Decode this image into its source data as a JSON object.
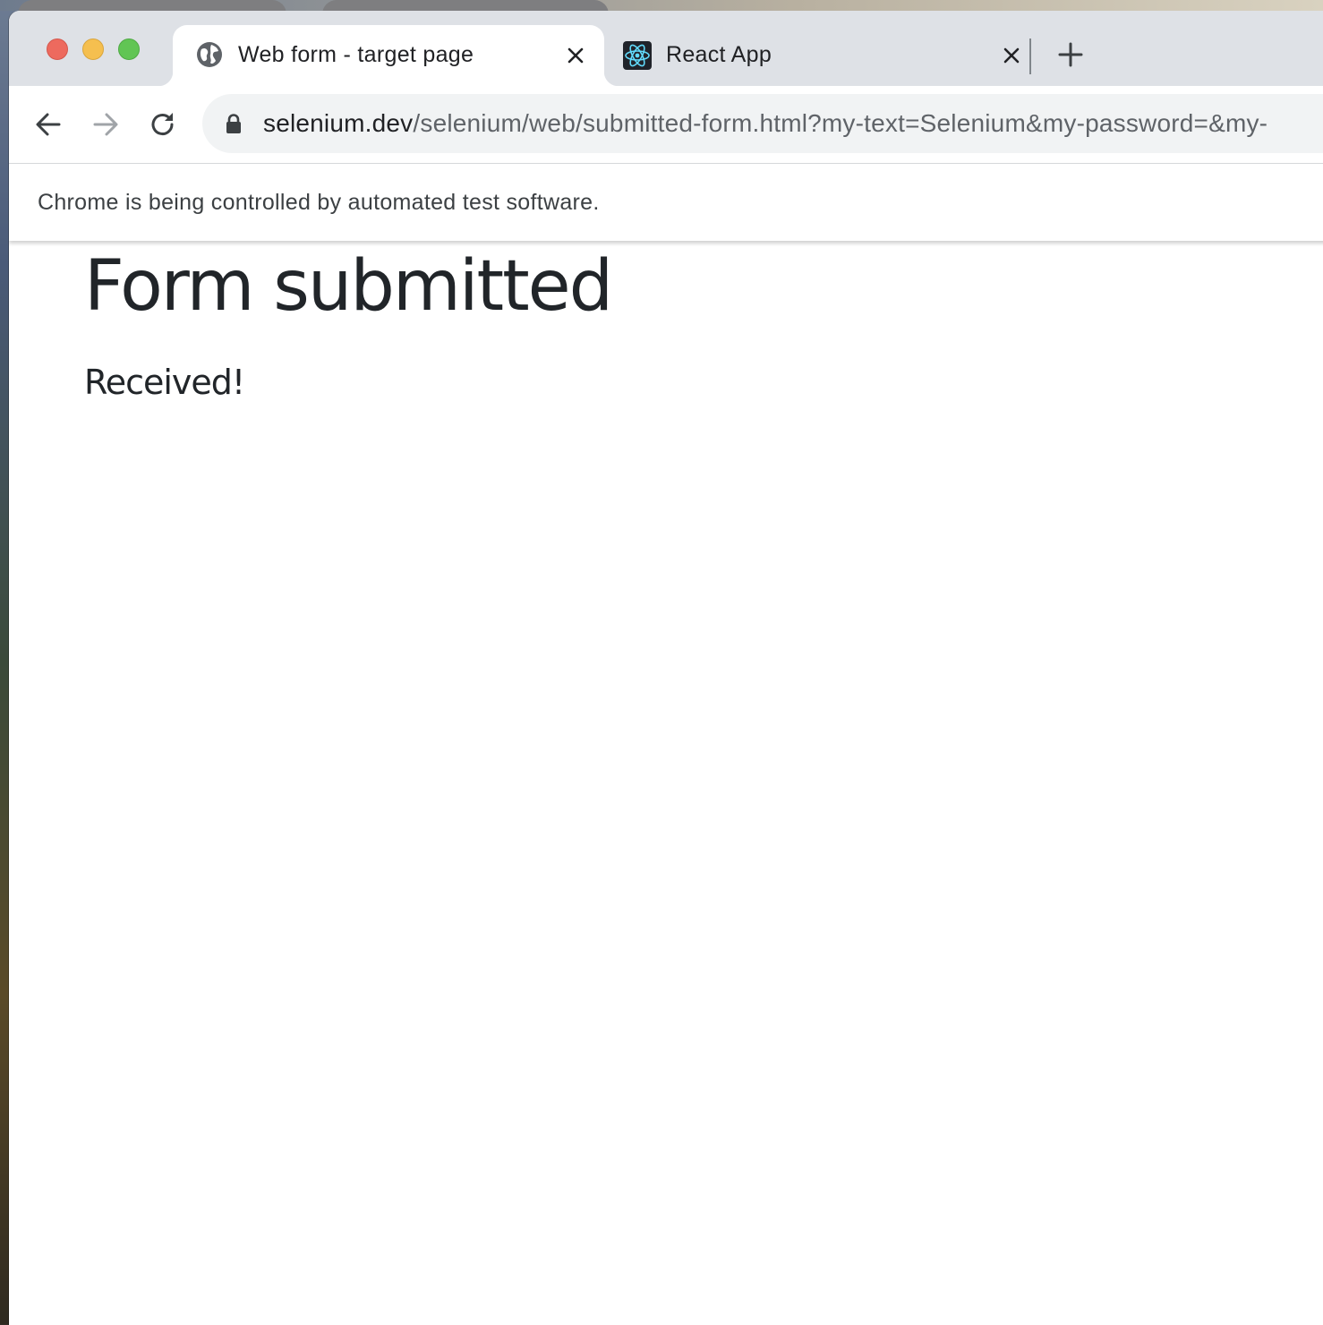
{
  "browser": {
    "tabs": [
      {
        "title": "Web form - target page",
        "favicon": "globe-icon",
        "active": true
      },
      {
        "title": "React App",
        "favicon": "react-logo-icon",
        "active": false
      }
    ],
    "address": {
      "host": "selenium.dev",
      "path": "/selenium/web/submitted-form.html?my-text=Selenium&my-password=&my-"
    },
    "infobar": {
      "text": "Chrome is being controlled by automated test software."
    }
  },
  "page": {
    "title": "Form submitted",
    "lead": "Received!"
  },
  "colors": {
    "tabstrip": "#dee1e6",
    "omnibox": "#f1f3f4",
    "text": "#212529",
    "close_red": "#ed6a5e",
    "minimize_yellow": "#f5bf4f",
    "zoom_green": "#61c554"
  }
}
